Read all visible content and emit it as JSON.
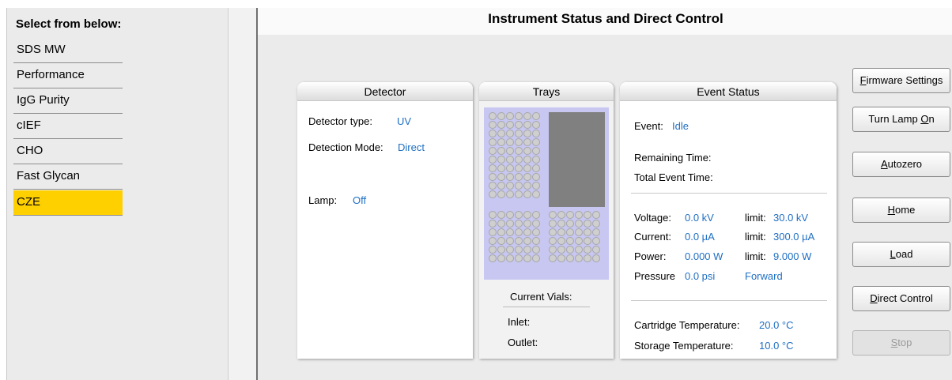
{
  "left_panel": {
    "header": "Select from below:",
    "methods": [
      {
        "label": "SDS MW"
      },
      {
        "label": "Performance"
      },
      {
        "label": "IgG Purity"
      },
      {
        "label": "cIEF"
      },
      {
        "label": "CHO"
      },
      {
        "label": "Fast Glycan"
      },
      {
        "label": "CZE",
        "selected": true
      }
    ]
  },
  "title": "Instrument Status and Direct Control",
  "detector": {
    "header": "Detector",
    "type_label": "Detector type:",
    "type_value": "UV",
    "mode_label": "Detection Mode:",
    "mode_value": "Direct",
    "lamp_label": "Lamp:",
    "lamp_value": "Off"
  },
  "trays": {
    "header": "Trays",
    "current_vials": "Current Vials:",
    "inlet_label": "Inlet:",
    "outlet_label": "Outlet:"
  },
  "event_status": {
    "header": "Event Status",
    "event_label": "Event:",
    "event_value": "Idle",
    "remaining_label": "Remaining Time:",
    "total_label": "Total Event Time:",
    "voltage_label": "Voltage:",
    "voltage_value": "0.0 kV",
    "voltage_limit_label": "limit:",
    "voltage_limit_value": "30.0 kV",
    "current_label": "Current:",
    "current_value": "0.0 µA",
    "current_limit_label": "limit:",
    "current_limit_value": "300.0 µA",
    "power_label": "Power:",
    "power_value": "0.000 W",
    "power_limit_label": "limit:",
    "power_limit_value": "9.000 W",
    "pressure_label": "Pressure",
    "pressure_value": "0.0 psi",
    "pressure_direction": "Forward",
    "cartridge_temp_label": "Cartridge Temperature:",
    "cartridge_temp_value": "20.0 °C",
    "storage_temp_label": "Storage Temperature:",
    "storage_temp_value": "10.0 °C"
  },
  "buttons": {
    "firmware_first": "F",
    "firmware_rest": "irmware Settings",
    "lamp_prefix": "Turn Lamp ",
    "lamp_mnemonic": "O",
    "lamp_suffix": "n",
    "autozero_first": "A",
    "autozero_rest": "utozero",
    "home_first": "H",
    "home_rest": "ome",
    "load_first": "L",
    "load_rest": "oad",
    "direct_first": "D",
    "direct_rest": "irect Control",
    "stop_first": "S",
    "stop_rest": "top"
  }
}
